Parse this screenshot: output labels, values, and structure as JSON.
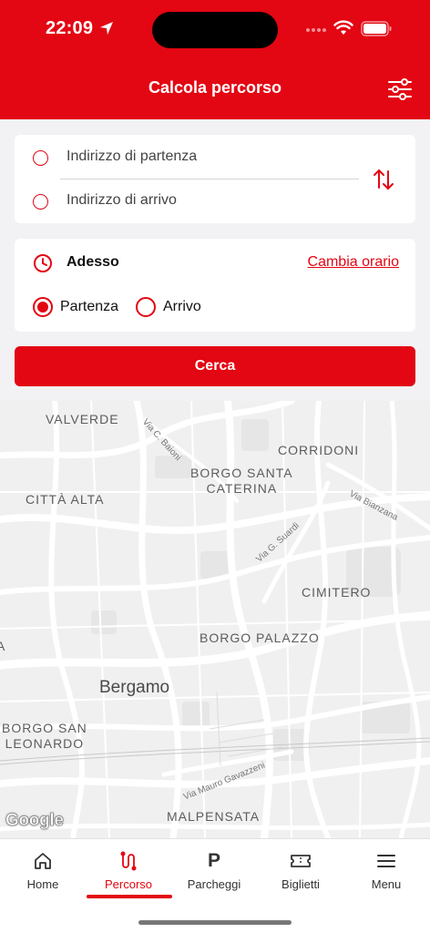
{
  "status_bar": {
    "time": "22:09"
  },
  "header": {
    "title": "Calcola percorso"
  },
  "route": {
    "start_placeholder": "Indirizzo di partenza",
    "end_placeholder": "Indirizzo di arrivo"
  },
  "time_options": {
    "now_label": "Adesso",
    "change_link": "Cambia orario",
    "departure_label": "Partenza",
    "arrival_label": "Arrivo",
    "selected": "Partenza"
  },
  "search_button": "Cerca",
  "map": {
    "city": "Bergamo",
    "districts": {
      "valverde": "VALVERDE",
      "corridoni": "CORRIDONI",
      "borgo_santa_caterina_1": "BORGO SANTA",
      "borgo_santa_caterina_2": "CATERINA",
      "citta_alta": "CITTÀ ALTA",
      "cimitero": "CIMITERO",
      "borgo_palazzo": "BORGO PALAZZO",
      "borgo_san_leonardo_1": "BORGO SAN",
      "borgo_san_leonardo_2": "LEONARDO",
      "malpensata": "MALPENSATA",
      "edge_left": "A"
    },
    "streets": {
      "baioni": "Via C. Baioni",
      "bianzana": "Via Bianzana",
      "suardi": "Via G. Suardi",
      "gavazzeni": "Via Mauro Gavazzeni"
    },
    "attribution": "Google"
  },
  "tabs": [
    {
      "label": "Home",
      "icon": "home-icon"
    },
    {
      "label": "Percorso",
      "icon": "route-icon",
      "active": true
    },
    {
      "label": "Parcheggi",
      "icon": "parking-icon"
    },
    {
      "label": "Biglietti",
      "icon": "ticket-icon"
    },
    {
      "label": "Menu",
      "icon": "menu-icon"
    }
  ],
  "colors": {
    "brand": "#e30613",
    "map_bg": "#f0f0f0",
    "road": "#ffffff"
  }
}
